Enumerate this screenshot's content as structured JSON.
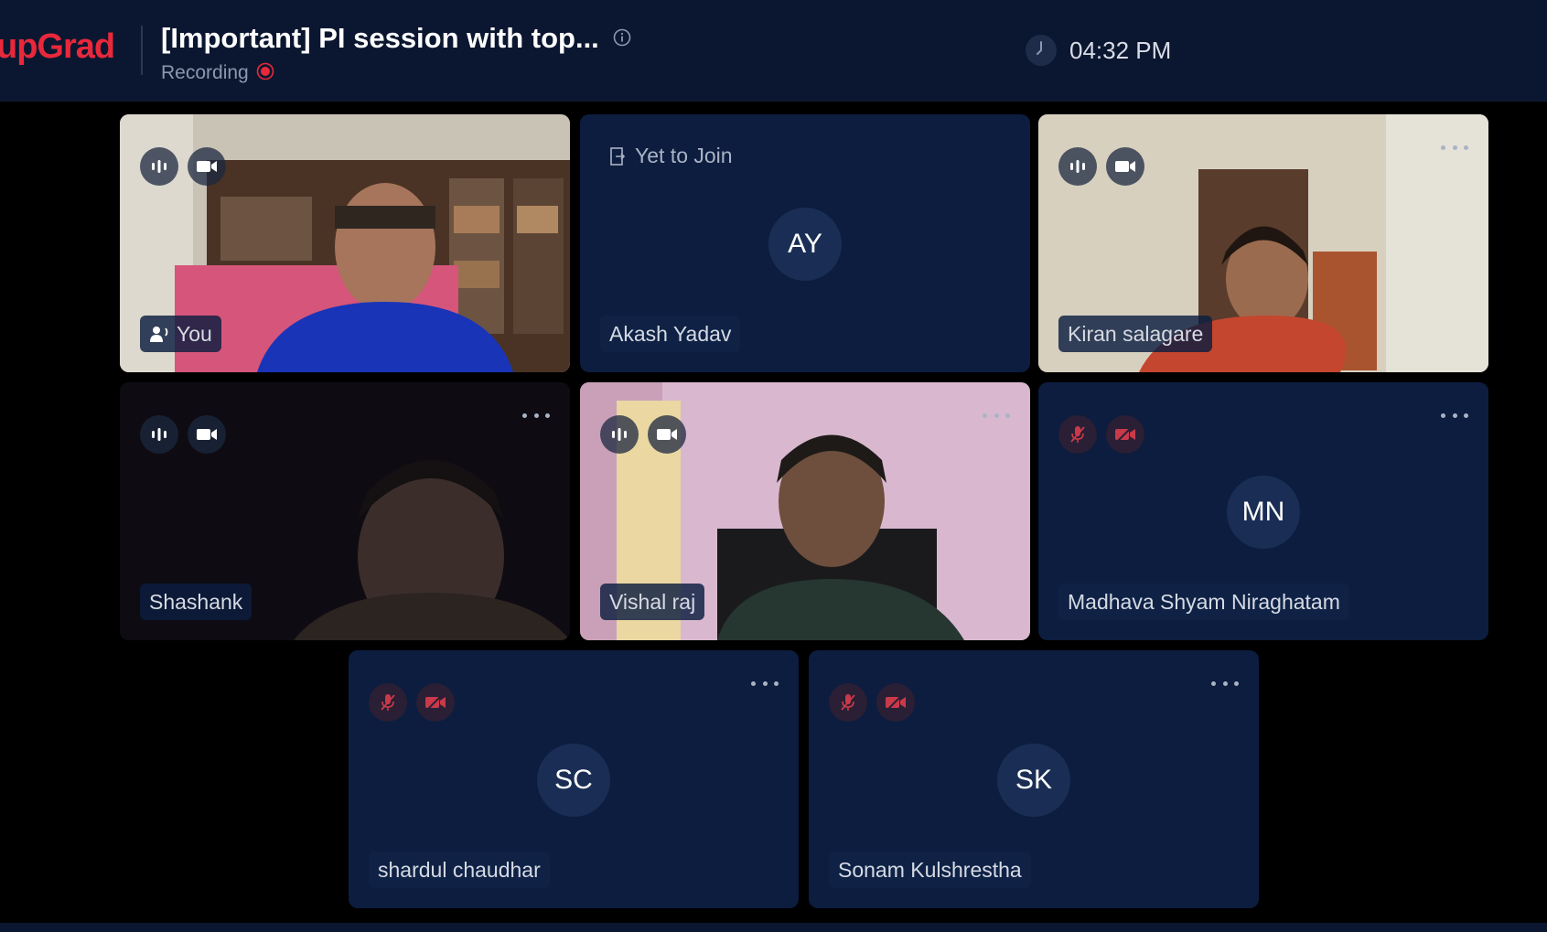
{
  "app": {
    "logo": "upGrad"
  },
  "header": {
    "title": "[Important] PI session with top...",
    "recording_label": "Recording",
    "time": "04:32 PM"
  },
  "icons": {
    "mic": "mic-icon",
    "mic_off": "mic-off-icon",
    "camera": "camera-icon",
    "camera_off": "camera-off-icon",
    "more": "more-options-icon",
    "speaker": "active-speaker-icon",
    "info": "info-icon",
    "recording": "recording-dot-icon",
    "clock": "clock-icon",
    "join": "join-door-icon"
  },
  "colors": {
    "brand": "#e8283b",
    "tile_bg": "#0c1d3f",
    "topbar_bg": "#0b1730",
    "muted_red": "#c83a4a"
  },
  "participants": [
    {
      "name": "You",
      "initials": "",
      "video": true
    },
    {
      "name": "Akash Yadav",
      "initials": "AY",
      "status": "Yet to Join",
      "video": false
    },
    {
      "name": "Kiran salagare",
      "initials": "",
      "video": true
    },
    {
      "name": "Shashank",
      "initials": "",
      "video": true
    },
    {
      "name": "Vishal raj",
      "initials": "",
      "video": true
    },
    {
      "name": "Madhava Shyam Niraghatam",
      "initials": "MN",
      "video": false,
      "muted": true
    },
    {
      "name": "shardul chaudhar",
      "initials": "SC",
      "video": false,
      "muted": true
    },
    {
      "name": "Sonam Kulshrestha",
      "initials": "SK",
      "video": false,
      "muted": true
    }
  ]
}
